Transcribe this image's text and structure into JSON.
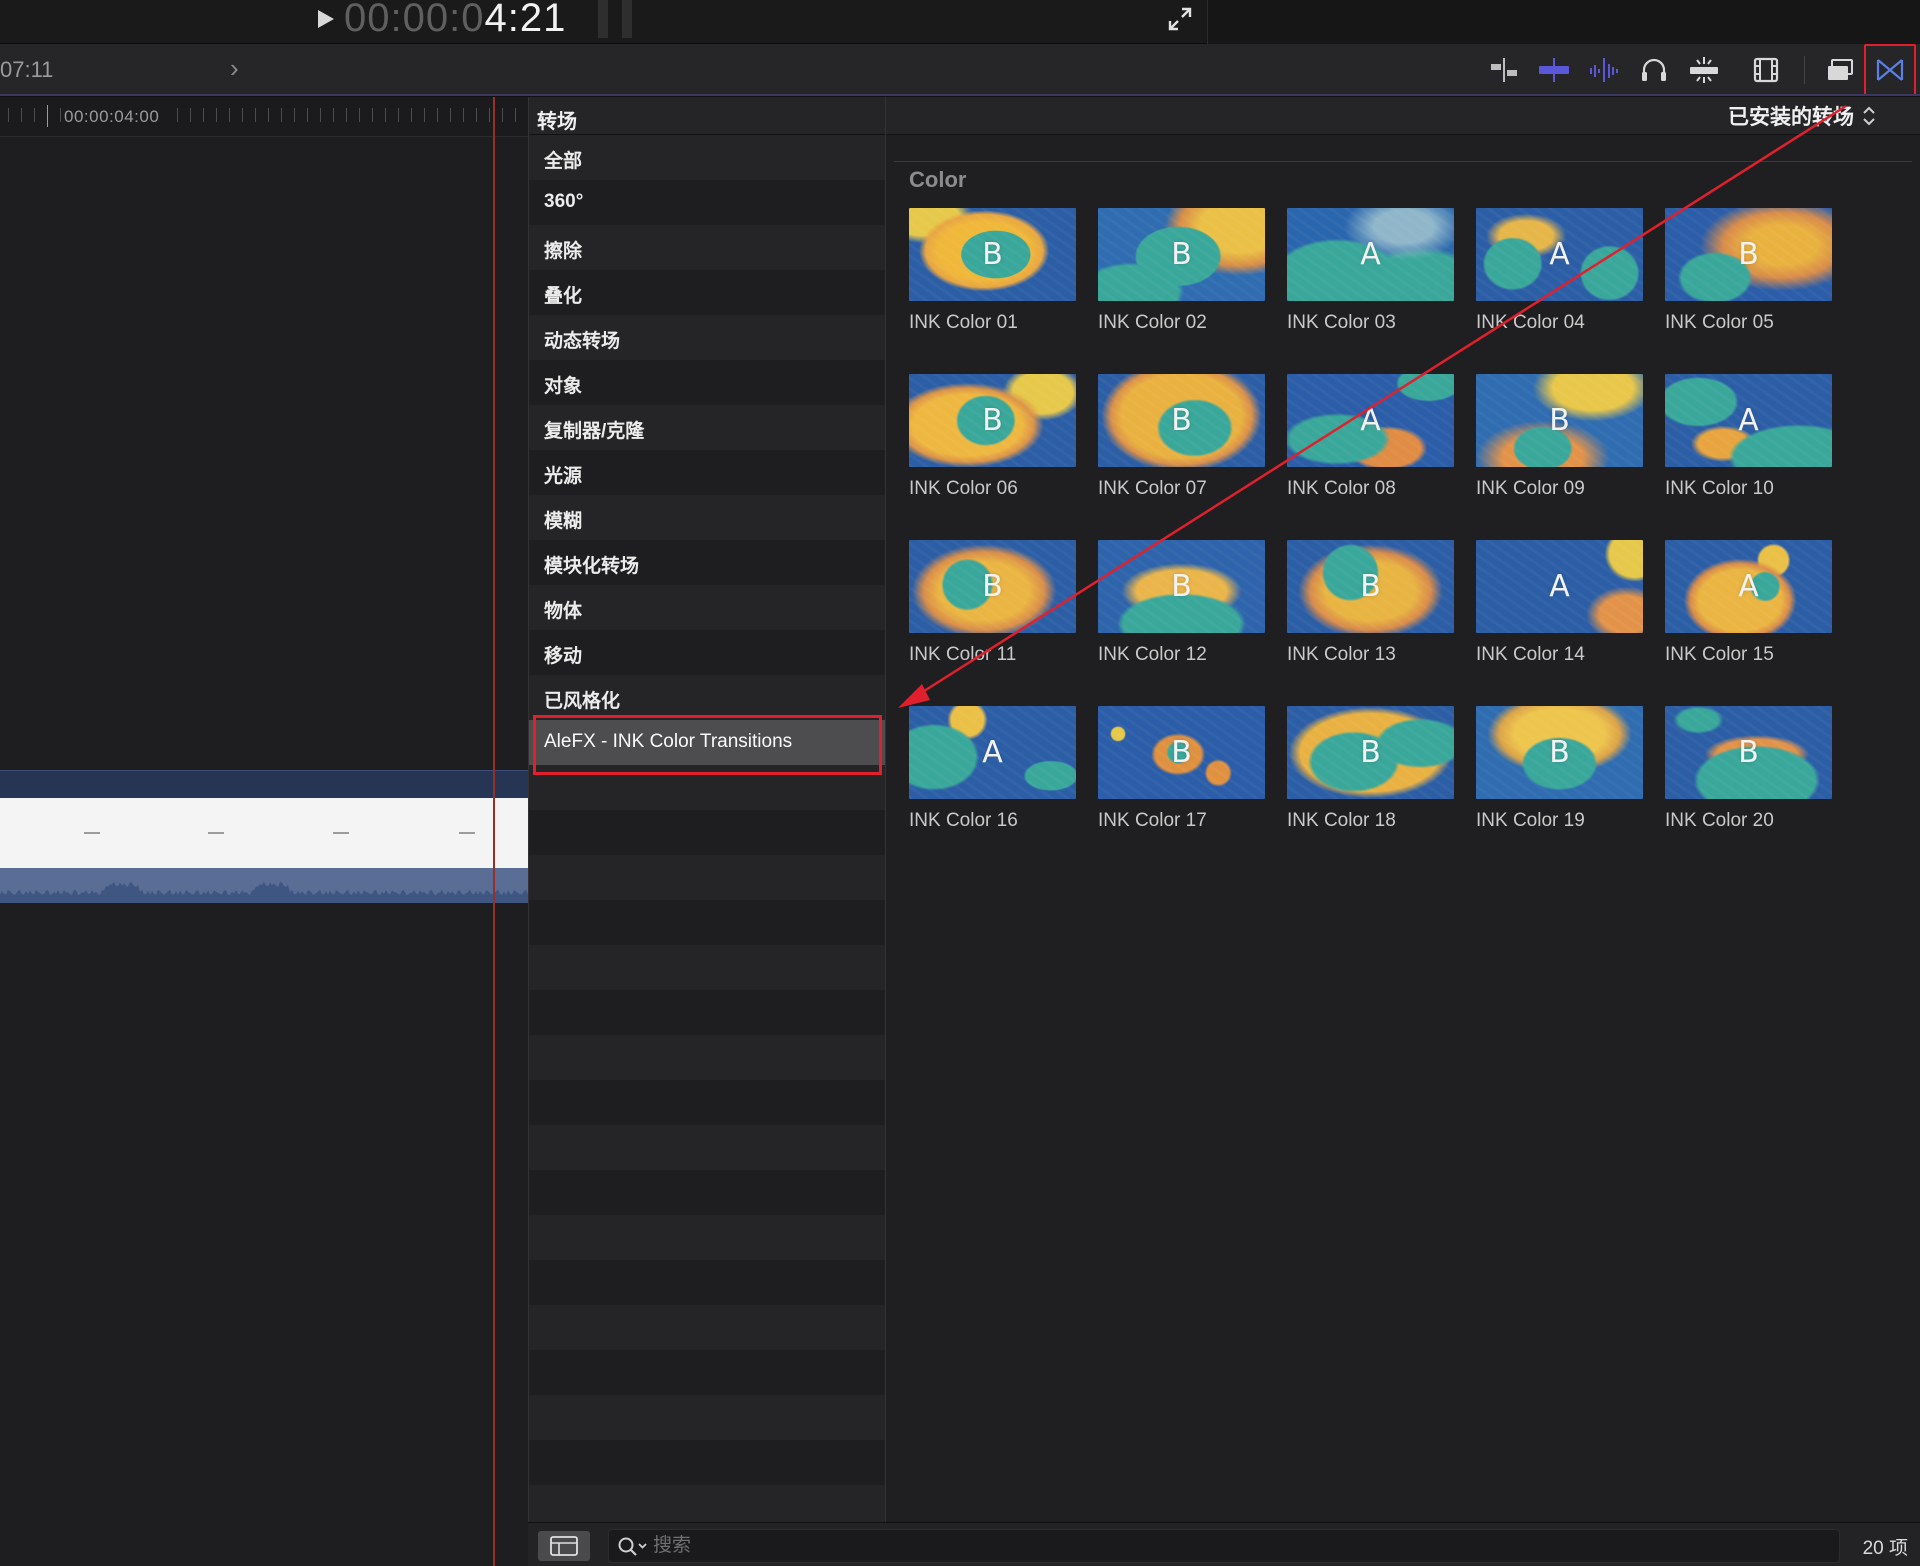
{
  "viewer": {
    "timecode_dim": "00:00:0",
    "timecode_bright": "4:21"
  },
  "toolbar": {
    "duration": "07:11",
    "nav_chevron": "›",
    "tools": [
      {
        "name": "snapping-icon"
      },
      {
        "name": "skimming-icon"
      },
      {
        "name": "audio-skimming-icon"
      },
      {
        "name": "headphones-icon"
      },
      {
        "name": "solo-icon"
      },
      {
        "name": "clip-appearance-icon"
      },
      {
        "name": "window-layout-icon"
      },
      {
        "name": "transitions-browser-icon"
      }
    ]
  },
  "timeline": {
    "ruler_label": "00:00:04:00"
  },
  "sidebar": {
    "title": "转场",
    "categories": [
      {
        "label": "全部"
      },
      {
        "label": "360°"
      },
      {
        "label": "擦除"
      },
      {
        "label": "叠化"
      },
      {
        "label": "动态转场"
      },
      {
        "label": "对象"
      },
      {
        "label": "复制器/克隆"
      },
      {
        "label": "光源"
      },
      {
        "label": "模糊"
      },
      {
        "label": "模块化转场"
      },
      {
        "label": "物体"
      },
      {
        "label": "移动"
      },
      {
        "label": "已风格化"
      },
      {
        "label": "AleFX - INK Color Transitions",
        "selected": true
      }
    ]
  },
  "browser": {
    "filter_label": "已安装的转场",
    "section_label": "Color",
    "thumbnails": [
      {
        "label": "INK Color 01",
        "letter": "B"
      },
      {
        "label": "INK Color 02",
        "letter": "B"
      },
      {
        "label": "INK Color 03",
        "letter": "A"
      },
      {
        "label": "INK Color 04",
        "letter": "A"
      },
      {
        "label": "INK Color 05",
        "letter": "B"
      },
      {
        "label": "INK Color 06",
        "letter": "B"
      },
      {
        "label": "INK Color 07",
        "letter": "B"
      },
      {
        "label": "INK Color 08",
        "letter": "A"
      },
      {
        "label": "INK Color 09",
        "letter": "B"
      },
      {
        "label": "INK Color 10",
        "letter": "A"
      },
      {
        "label": "INK Color 11",
        "letter": "B"
      },
      {
        "label": "INK Color 12",
        "letter": "B"
      },
      {
        "label": "INK Color 13",
        "letter": "B"
      },
      {
        "label": "INK Color 14",
        "letter": "A"
      },
      {
        "label": "INK Color 15",
        "letter": "A"
      },
      {
        "label": "INK Color 16",
        "letter": "A"
      },
      {
        "label": "INK Color 17",
        "letter": "B"
      },
      {
        "label": "INK Color 18",
        "letter": "B"
      },
      {
        "label": "INK Color 19",
        "letter": "B"
      },
      {
        "label": "INK Color 20",
        "letter": "B"
      }
    ]
  },
  "footer": {
    "search_placeholder": "搜索",
    "item_count": "20 项"
  },
  "colors": {
    "annotation_red": "#e0202c",
    "playhead": "#9a2f2a",
    "clip_header": "#263553",
    "clip_audio": "#5a6d95",
    "ink_teal": "#3aa79b",
    "ink_yellow": "#eac046",
    "ink_blue": "#2c5ea6"
  }
}
